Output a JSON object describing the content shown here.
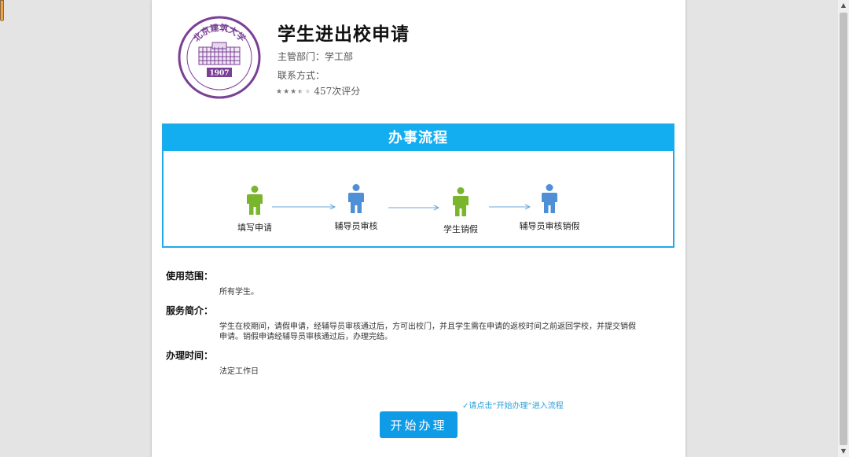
{
  "header": {
    "title": "学生进出校申请",
    "department": "主管部门：学工部",
    "contact": "联系方式：",
    "rating": {
      "stars": 3.5,
      "max": 5,
      "text": "457次评分"
    },
    "logo": {
      "top_text": "北京建筑大学",
      "year": "1907"
    }
  },
  "process": {
    "title": "办事流程",
    "steps": [
      {
        "label": "填写申请",
        "color": "#79b52d"
      },
      {
        "label": "辅导员审核",
        "color": "#4f8fd6"
      },
      {
        "label": "学生销假",
        "color": "#79b52d"
      },
      {
        "label": "辅导员审核销假",
        "color": "#4f8fd6"
      }
    ]
  },
  "info": {
    "scope_title": "使用范围：",
    "scope_text": "所有学生。",
    "intro_title": "服务简介：",
    "intro_text": "学生在校期间，请假申请，经辅导员审核通过后，方可出校门，并且学生需在申请的返校时间之前返回学校，并提交销假申请。销假申请经辅导员审核通过后，办理完结。",
    "time_title": "办理时间：",
    "time_text": "法定工作日"
  },
  "action": {
    "hint": "✓请点击“开始办理”进入流程",
    "button_label": "开始办理"
  },
  "colors": {
    "accent": "#12aef0",
    "button": "#0f9be6",
    "logo_purple": "#7a3f96"
  },
  "icons": {
    "person": "person-icon",
    "arrow": "arrow-right-icon",
    "logo": "university-seal-icon"
  }
}
